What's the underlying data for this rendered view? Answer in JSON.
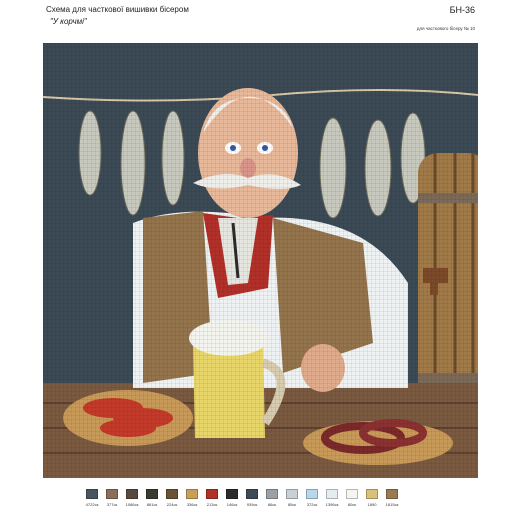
{
  "header": {
    "title": "Схема для часткової вишивки бісером",
    "subtitle": "\"У корчмі\"",
    "code": "БН-36",
    "note": "для часткового бісеру № 10"
  },
  "legend": [
    {
      "code": "4722ск",
      "color": "#4a5560"
    },
    {
      "code": "377ск",
      "color": "#8a6e5c"
    },
    {
      "code": "1086ск",
      "color": "#5a4a3e"
    },
    {
      "code": "861ск",
      "color": "#3a3a30"
    },
    {
      "code": "224ск",
      "color": "#6a5236"
    },
    {
      "code": "336ск",
      "color": "#c9a05a"
    },
    {
      "code": "213ск",
      "color": "#b0302a"
    },
    {
      "code": "146ск",
      "color": "#2a2a2a"
    },
    {
      "code": "939ск",
      "color": "#3c4a58"
    },
    {
      "code": "86ск",
      "color": "#9aa0a6"
    },
    {
      "code": "85ск",
      "color": "#c8cfd6"
    },
    {
      "code": "372ск",
      "color": "#b9d7ea"
    },
    {
      "code": "1396ск",
      "color": "#e4ecf0"
    },
    {
      "code": "80ск",
      "color": "#f4f4f0"
    },
    {
      "code": "1890",
      "color": "#d8c27a"
    },
    {
      "code": "1815ск",
      "color": "#9a7a50"
    }
  ]
}
